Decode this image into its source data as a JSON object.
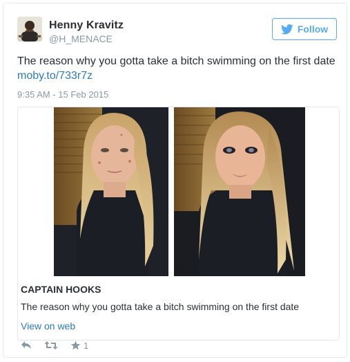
{
  "colors": {
    "twitter_blue": "#55acee",
    "link_blue": "#2b7bb9",
    "text": "#292f33",
    "muted": "#8899a6",
    "border": "#e1e8ed"
  },
  "user": {
    "name": "Henny Kravitz",
    "handle": "@H_MENACE",
    "avatar_icon": "user-avatar-photo"
  },
  "follow": {
    "label": "Follow",
    "icon": "twitter-bird-icon"
  },
  "tweet": {
    "text": "The reason why you gotta take a bitch swimming on the first date",
    "link": "moby.to/733r7z",
    "timestamp": "9:35 AM - 15 Feb 2015"
  },
  "card": {
    "image_description_icon": "before-after-photo",
    "title": "CAPTAIN HOOKS",
    "description": "The reason why you gotta take a bitch swimming on the first date"
  },
  "view_on_web": "View on web",
  "actions": {
    "reply_icon": "reply-icon",
    "retweet_icon": "retweet-icon",
    "favorite_icon": "star-icon",
    "favorite_count": "1"
  }
}
